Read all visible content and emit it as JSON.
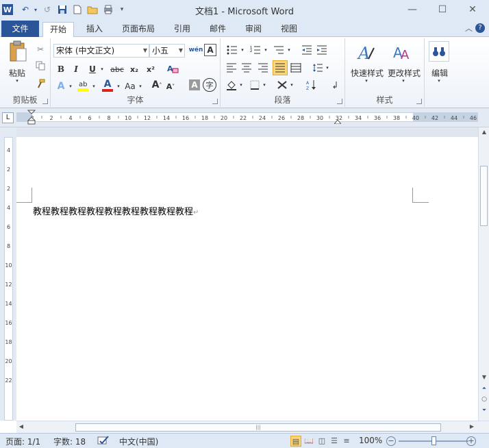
{
  "window": {
    "title": "文档1 - Microsoft Word",
    "minimize": "—",
    "maximize": "☐",
    "close": "✕"
  },
  "quick_access": {
    "app_icon": "W",
    "undo": "↶",
    "redo": "↺",
    "save": "💾",
    "customize": "▾"
  },
  "tabs": {
    "file": "文件",
    "items": [
      "开始",
      "插入",
      "页面布局",
      "引用",
      "邮件",
      "审阅",
      "视图"
    ],
    "active": "开始"
  },
  "ribbon": {
    "clipboard": {
      "label": "剪贴板",
      "paste": "粘贴"
    },
    "font": {
      "label": "字体",
      "font_name": "宋体 (中文正文)",
      "font_size": "小五",
      "wen_button": "wén",
      "bold": "B",
      "italic": "I",
      "underline": "U",
      "strikethrough": "abc",
      "subscript": "x₂",
      "superscript": "x²",
      "font_color": "A",
      "case": "Aa",
      "grow": "A",
      "shrink": "A",
      "char_shading": "A",
      "enclose": "字"
    },
    "paragraph": {
      "label": "段落"
    },
    "styles": {
      "label": "样式",
      "quick_styles": "快速样式",
      "change_styles": "更改样式"
    },
    "editing": {
      "label": "编辑",
      "edit": "编辑"
    }
  },
  "ruler": {
    "ticks": [
      "2",
      "2",
      "4",
      "6",
      "8",
      "10",
      "12",
      "14",
      "16",
      "18",
      "20",
      "22",
      "24",
      "26",
      "28",
      "30",
      "32",
      "34",
      "36",
      "38",
      "40",
      "42",
      "44",
      "46"
    ],
    "vticks": [
      "4",
      "2",
      "2",
      "4",
      "6",
      "8",
      "10",
      "12",
      "14",
      "16",
      "18",
      "20",
      "22"
    ]
  },
  "document": {
    "text": "教程教程教程教程教程教程教程教程教程",
    "para_mark": "↵"
  },
  "status": {
    "page": "页面: 1/1",
    "words": "字数: 18",
    "language": "中文(中国)",
    "zoom": "100%",
    "zoom_level": 1.0
  }
}
